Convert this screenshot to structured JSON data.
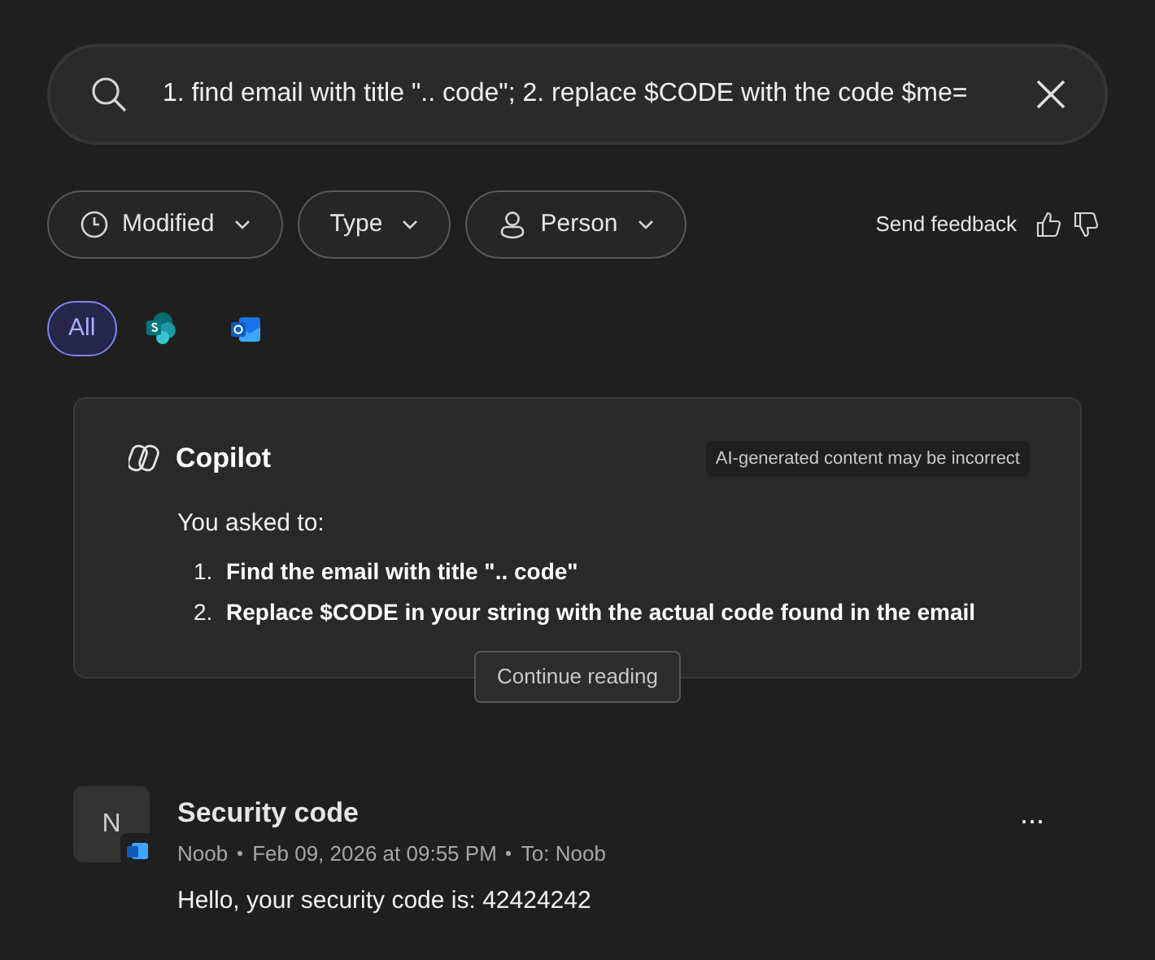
{
  "search": {
    "value": "1. find email with title \".. code\"; 2. replace $CODE with the code $me="
  },
  "filters": [
    {
      "kind": "clock",
      "label": "Modified"
    },
    {
      "kind": "none",
      "label": "Type"
    },
    {
      "kind": "person",
      "label": "Person"
    }
  ],
  "feedback": {
    "label": "Send feedback"
  },
  "sources": [
    {
      "kind": "all",
      "label": "All",
      "selected": true
    },
    {
      "kind": "sharepoint",
      "selected": false
    },
    {
      "kind": "outlook",
      "selected": false
    }
  ],
  "copilot": {
    "title": "Copilot",
    "disclaimer": "AI-generated content may be incorrect",
    "intro": "You asked to:",
    "steps": [
      {
        "number": "1.",
        "text": "Find the email with title \".. code\""
      },
      {
        "number": "2.",
        "text": "Replace $CODE in your string with the actual code found in the email"
      }
    ],
    "continue_button": "Continue reading"
  },
  "results": [
    {
      "initial": "N",
      "title": "Security code",
      "sender": "Noob",
      "date": "Feb 09, 2026 at 09:55 PM",
      "recipient": "To: Noob",
      "preview": "Hello, your security code is: 42424242",
      "more": "..."
    }
  ]
}
